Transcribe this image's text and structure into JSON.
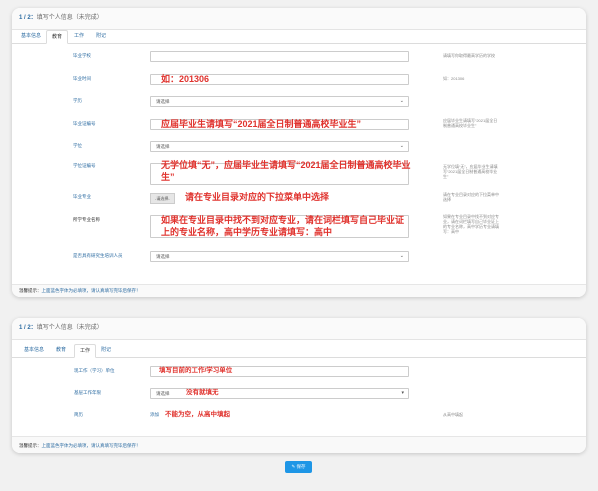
{
  "card1": {
    "step": "1 / 2：",
    "title": "填写个人信息（未完成）",
    "tabs": [
      "基本信息",
      "教育",
      "工作",
      "附记"
    ],
    "fields": [
      {
        "label": "毕业学校",
        "hint": "请填写你取得最高学历的学校"
      },
      {
        "label": "毕业时间",
        "overlay": "如：201306",
        "hint": "如：201306"
      },
      {
        "label": "学历",
        "select": "请选择"
      },
      {
        "label": "毕业证编号",
        "overlay": "应届毕业生请填写“2021届全日制普通高校毕业生”",
        "hint": "应届毕业生请填写“2021届全日制普通高校毕业生”"
      },
      {
        "label": "学位",
        "select": "请选择"
      },
      {
        "label": "学位证编号",
        "overlay": "无学位填“无”，应届毕业生请填写“2021届全日制普通高校毕业生”",
        "hint": "无学位填“无”，应届毕业生请填写“2021届全日制普通高校毕业生”"
      },
      {
        "label": "毕业专业",
        "button": "-请选择-",
        "overlay": "请在专业目录对应的下拉菜单中选择",
        "hint": "请在专业目录对应的下拉菜单中选择"
      },
      {
        "label": "所学专业名称",
        "overlay": "如果在专业目录中找不到对应专业，请在词栏填写自己毕业证上的专业名称，高中学历专业请填写：高中",
        "hint": "如果在专业目录中找不到对应专业，请在词栏填写自己毕业证上的专业名称，高中学历专业请填写：高中"
      },
      {
        "label": "是否具有研究生培训人员",
        "select": "请选择"
      }
    ],
    "footer_label": "温馨提示：",
    "footer_text": "上面蓝色字体为必填项，请认真填写完毕后保存！"
  },
  "card2": {
    "step": "1 / 2：",
    "title": "填写个人信息（未完成）",
    "tabs": [
      "基本信息",
      "教育",
      "工作",
      "附记"
    ],
    "fields": [
      {
        "label": "现工作（学习）单位",
        "overlay": "填写目前的工作/学习单位"
      },
      {
        "label": "基层工作年限",
        "select": "请选择",
        "overlay": "没有就填无"
      },
      {
        "label": "简历",
        "add": "添加",
        "overlay": "不能为空，从高中填起",
        "hint": "从高中填起"
      }
    ],
    "footer_label": "温馨提示：",
    "footer_text": "上面蓝色字体为必填项，请认真填写完毕后保存！"
  },
  "save_label": "✎ 保存"
}
